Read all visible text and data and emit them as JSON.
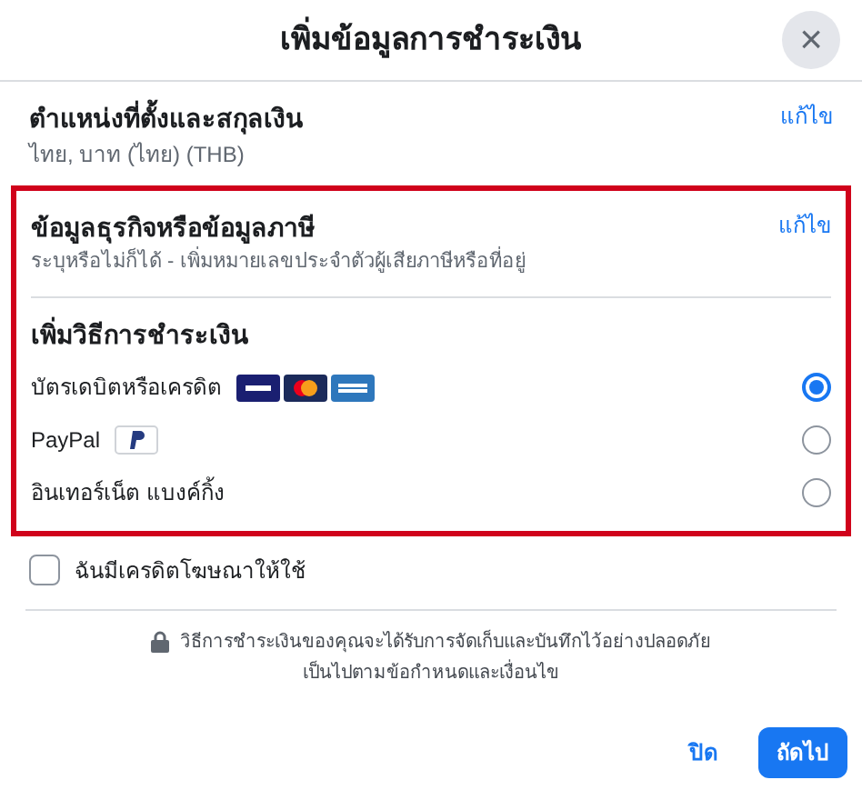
{
  "dialog": {
    "title": "เพิ่มข้อมูลการชำระเงิน",
    "close": "×"
  },
  "location": {
    "title": "ตำแหน่งที่ตั้งและสกุลเงิน",
    "value": "ไทย, บาท (ไทย) (THB)",
    "edit": "แก้ไข"
  },
  "business": {
    "title": "ข้อมูลธุรกิจหรือข้อมูลภาษี",
    "value": "ระบุหรือไม่ก็ได้ - เพิ่มหมายเลขประจำตัวผู้เสียภาษีหรือที่อยู่",
    "edit": "แก้ไข"
  },
  "payment": {
    "title": "เพิ่มวิธีการชำระเงิน",
    "methods": [
      {
        "label": "บัตรเดบิตหรือเครดิต",
        "kind": "cards",
        "selected": true
      },
      {
        "label": "PayPal",
        "kind": "paypal",
        "selected": false
      },
      {
        "label": "อินเทอร์เน็ต แบงค์กิ้ง",
        "kind": "plain",
        "selected": false
      }
    ]
  },
  "ad_credit": {
    "label": "ฉันมีเครดิตโฆษณาให้ใช้",
    "checked": false
  },
  "security_note": [
    "วิธีการชำระเงินของคุณจะได้รับการจัดเก็บและบันทึกไว้อย่างปลอดภัย",
    "เป็นไปตามข้อกำหนดและเงื่อนไข"
  ],
  "buttons": {
    "close": "ปิด",
    "next": "ถัดไป"
  }
}
